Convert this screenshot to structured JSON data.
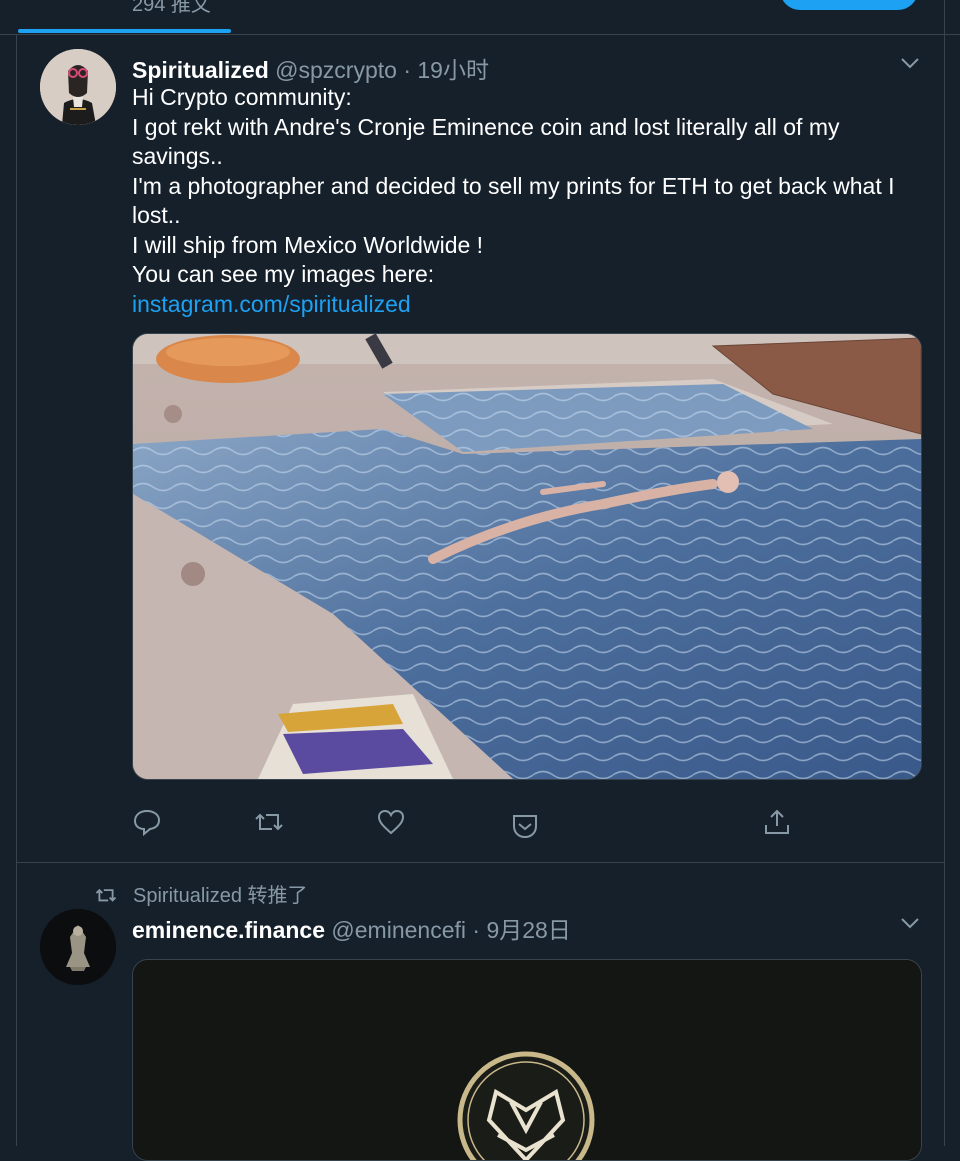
{
  "header": {
    "tweet_count_label": "294 推文"
  },
  "tweets": [
    {
      "display_name": "Spiritualized",
      "handle": "@spzcrypto",
      "separator": "·",
      "timestamp": "19小时",
      "text_lines": [
        "Hi Crypto community:",
        "I got rekt with Andre's Cronje Eminence coin and lost literally all of my savings..",
        "I'm a photographer and decided to sell my prints for ETH to get back what I lost..",
        "I will ship from Mexico Worldwide !",
        "You can see my images here:"
      ],
      "link": "instagram.com/spiritualized",
      "actions": [
        "reply-icon",
        "retweet-icon",
        "like-icon",
        "save-icon",
        "share-icon"
      ]
    },
    {
      "retweet_context": "Spiritualized 转推了",
      "display_name": "eminence.finance",
      "handle": "@eminencefi",
      "separator": "·",
      "timestamp": "9月28日"
    }
  ],
  "colors": {
    "background": "#15202b",
    "border": "#38444d",
    "muted_text": "#8899a6",
    "link": "#1da1f2",
    "logo_gold": "#c9b98a"
  }
}
